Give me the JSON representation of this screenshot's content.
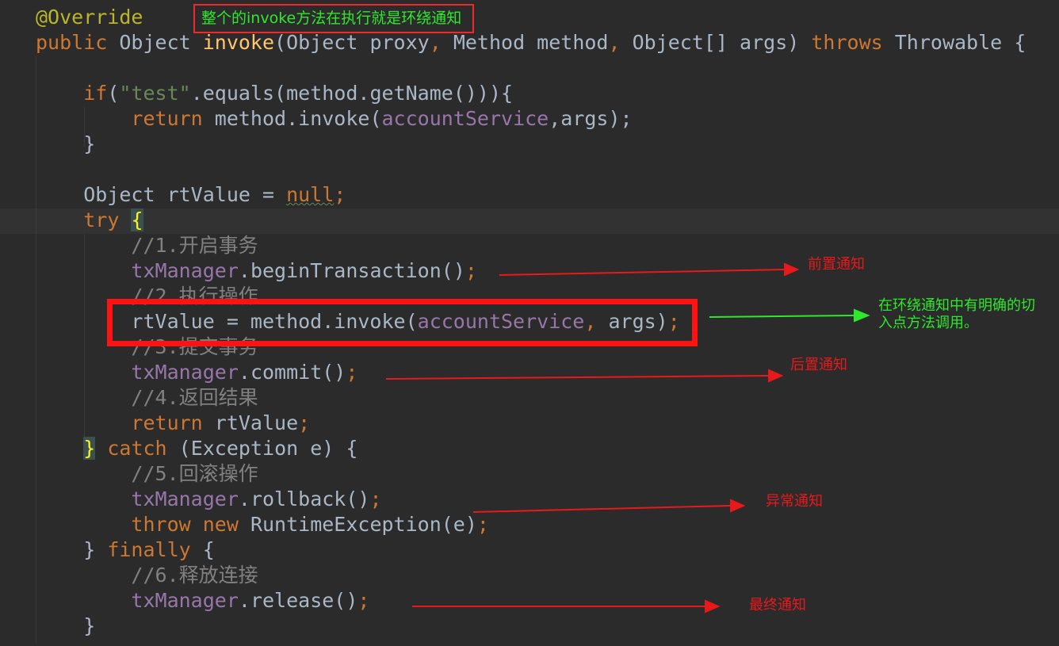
{
  "code_lines": [
    [
      [
        "@Override",
        "an"
      ]
    ],
    [
      [
        "public ",
        "kw"
      ],
      [
        "Object ",
        ""
      ],
      [
        "invoke",
        "fn"
      ],
      [
        "(Object proxy",
        ""
      ],
      [
        ", ",
        "kw"
      ],
      [
        "Method method",
        ""
      ],
      [
        ", ",
        "kw"
      ],
      [
        "Object[] args) ",
        ""
      ],
      [
        "throws ",
        "kw"
      ],
      [
        "Throwable {",
        ""
      ]
    ],
    [],
    [
      [
        "    ",
        ""
      ],
      [
        "if",
        "kw"
      ],
      [
        "(",
        ""
      ],
      [
        "\"test\"",
        "st"
      ],
      [
        ".equals(method.getName())){",
        ""
      ]
    ],
    [
      [
        "        ",
        ""
      ],
      [
        "return ",
        "kw"
      ],
      [
        "method.invoke(",
        ""
      ],
      [
        "accountService",
        "fd"
      ],
      [
        ",",
        ""
      ],
      [
        "args);",
        ""
      ]
    ],
    [
      [
        "    }",
        ""
      ]
    ],
    [],
    [
      [
        "    Object rtValue = ",
        ""
      ],
      [
        "null",
        "kw nul"
      ],
      [
        ";",
        "kw"
      ]
    ],
    [
      [
        "    ",
        ""
      ],
      [
        "try ",
        "kw"
      ],
      [
        "{",
        "br"
      ]
    ],
    [
      [
        "        //1.开启事务",
        "cm"
      ]
    ],
    [
      [
        "        ",
        ""
      ],
      [
        "txManager",
        "fd"
      ],
      [
        ".beginTransaction()",
        ""
      ],
      [
        ";",
        "kw"
      ]
    ],
    [
      [
        "        //2.执行操作",
        "cm"
      ]
    ],
    [
      [
        "        rtValue = method.invoke(",
        ""
      ],
      [
        "accountService",
        "fd"
      ],
      [
        ", ",
        "kw"
      ],
      [
        "args)",
        ""
      ],
      [
        ";",
        "kw"
      ]
    ],
    [
      [
        "        //3.提交事务",
        "cm"
      ]
    ],
    [
      [
        "        ",
        ""
      ],
      [
        "txManager",
        "fd"
      ],
      [
        ".commit()",
        ""
      ],
      [
        ";",
        "kw"
      ]
    ],
    [
      [
        "        //4.返回结果",
        "cm"
      ]
    ],
    [
      [
        "        ",
        ""
      ],
      [
        "return ",
        "kw"
      ],
      [
        "rtValue",
        ""
      ],
      [
        ";",
        "kw"
      ]
    ],
    [
      [
        "    ",
        ""
      ],
      [
        "}",
        "br"
      ],
      [
        " ",
        ""
      ],
      [
        "catch ",
        "kw"
      ],
      [
        "(Exception e) {",
        ""
      ]
    ],
    [
      [
        "        //5.回滚操作",
        "cm"
      ]
    ],
    [
      [
        "        ",
        ""
      ],
      [
        "txManager",
        "fd"
      ],
      [
        ".rollback()",
        ""
      ],
      [
        ";",
        "kw"
      ]
    ],
    [
      [
        "        ",
        ""
      ],
      [
        "throw new ",
        "kw"
      ],
      [
        "RuntimeException(e)",
        ""
      ],
      [
        ";",
        "kw"
      ]
    ],
    [
      [
        "    } ",
        ""
      ],
      [
        "finally ",
        "kw"
      ],
      [
        "{",
        ""
      ]
    ],
    [
      [
        "        //6.释放连接",
        "cm"
      ]
    ],
    [
      [
        "        ",
        ""
      ],
      [
        "txManager",
        "fd"
      ],
      [
        ".release()",
        ""
      ],
      [
        ";",
        "kw"
      ]
    ],
    [
      [
        "    }",
        ""
      ]
    ]
  ],
  "annotations": {
    "top": "整个的invoke方法在执行就是环绕通知",
    "before": "前置通知",
    "around_line1": "在环绕通知中有明确的切",
    "around_line2": "入点方法调用。",
    "after_returning": "后置通知",
    "after_throwing": "异常通知",
    "after": "最终通知"
  },
  "colors": {
    "background": "#2b2b2b",
    "keyword": "#cc7832",
    "annotation_red": "#e8191b",
    "annotation_green": "#2ee82b",
    "highlight_box": "#ff1212"
  }
}
